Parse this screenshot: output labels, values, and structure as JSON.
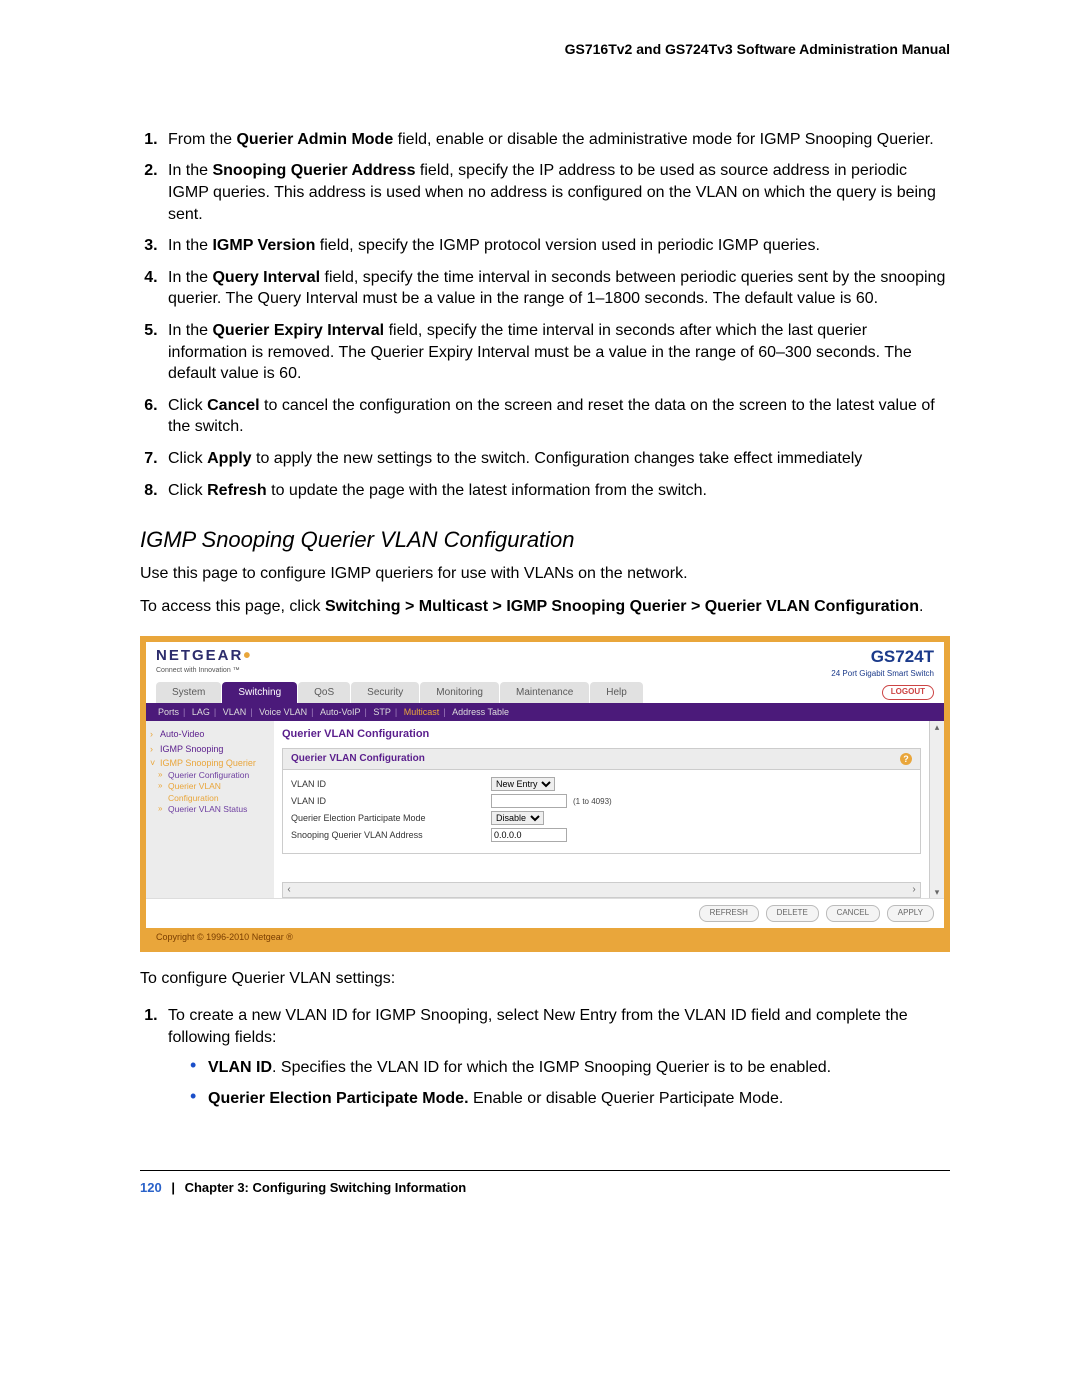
{
  "header": {
    "manual_title": "GS716Tv2 and GS724Tv3 Software Administration Manual"
  },
  "steps_top": [
    {
      "pre": "From the ",
      "bold": "Querier Admin Mode",
      "post": " field, enable or disable the administrative mode for IGMP Snooping Querier."
    },
    {
      "pre": "In the ",
      "bold": "Snooping Querier Address",
      "post": " field, specify the IP address to be used as source address in periodic IGMP queries. This address is used when no address is configured on the VLAN on which the query is being sent."
    },
    {
      "pre": "In the ",
      "bold": "IGMP Version",
      "post": " field, specify the IGMP protocol version used in periodic IGMP queries."
    },
    {
      "pre": "In the ",
      "bold": "Query Interval",
      "post": " field, specify the time interval in seconds between periodic queries sent by the snooping querier. The Query Interval must be a value in the range of 1–1800 seconds. The default value is 60."
    },
    {
      "pre": "In the ",
      "bold": "Querier Expiry Interval",
      "post": " field, specify the time interval in seconds after which the last querier information is removed. The Querier Expiry Interval must be a value in the range of 60–300 seconds. The default value is 60."
    },
    {
      "pre": "Click ",
      "bold": "Cancel",
      "post": " to cancel the configuration on the screen and reset the data on the screen to the latest value of the switch."
    },
    {
      "pre": "Click ",
      "bold": "Apply",
      "post": " to apply the new settings to the switch. Configuration changes take effect immediately"
    },
    {
      "pre": "Click ",
      "bold": "Refresh",
      "post": " to update the page with the latest information from the switch."
    }
  ],
  "section": {
    "heading": "IGMP Snooping Querier VLAN Configuration",
    "intro": "Use this page to configure IGMP queriers for use with VLANs on the network.",
    "access_pre": "To access this page, click ",
    "access_path": "Switching > Multicast > IGMP Snooping Querier > Querier VLAN Configuration",
    "access_post": "."
  },
  "screenshot": {
    "brand": "NETGEAR",
    "tagline": "Connect with Innovation ™",
    "model": "GS724T",
    "model_desc": "24 Port Gigabit Smart Switch",
    "tabs": [
      "System",
      "Switching",
      "QoS",
      "Security",
      "Monitoring",
      "Maintenance",
      "Help"
    ],
    "active_tab_index": 1,
    "logout": "LOGOUT",
    "subtabs": [
      "Ports",
      "LAG",
      "VLAN",
      "Voice VLAN",
      "Auto-VoIP",
      "STP",
      "Multicast",
      "Address Table"
    ],
    "active_subtab_index": 6,
    "sidebar": {
      "items": [
        {
          "label": "Auto-Video",
          "type": "item"
        },
        {
          "label": "IGMP Snooping",
          "type": "item"
        },
        {
          "label": "IGMP Snooping Querier",
          "type": "open",
          "highlight": true
        },
        {
          "label": "Querier Configuration",
          "type": "sub"
        },
        {
          "label": "Querier VLAN Configuration",
          "type": "sub",
          "highlight": true
        },
        {
          "label": "Querier VLAN Status",
          "type": "sub"
        }
      ]
    },
    "panel_title": "Querier VLAN Configuration",
    "box_title": "Querier VLAN Configuration",
    "rows": [
      {
        "label": "VLAN ID",
        "control": "select",
        "value": "New Entry"
      },
      {
        "label": "VLAN ID",
        "control": "text",
        "value": "",
        "hint": "(1 to 4093)"
      },
      {
        "label": "Querier Election Participate Mode",
        "control": "select",
        "value": "Disable"
      },
      {
        "label": "Snooping Querier VLAN Address",
        "control": "text",
        "value": "0.0.0.0"
      }
    ],
    "buttons": [
      "REFRESH",
      "DELETE",
      "CANCEL",
      "APPLY"
    ],
    "copyright": "Copyright © 1996-2010 Netgear ®"
  },
  "after": {
    "configure_line": "To configure Querier VLAN settings:",
    "step1_text": "To create a new VLAN ID for IGMP Snooping, select New Entry from the VLAN ID field and complete the following fields:",
    "bullets": [
      {
        "bold": "VLAN ID",
        "post": ". Specifies the VLAN ID for which the IGMP Snooping Querier is to be enabled."
      },
      {
        "bold": "Querier Election Participate Mode.",
        "post": " Enable or disable Querier Participate Mode."
      }
    ]
  },
  "footer": {
    "page_number": "120",
    "chapter": "Chapter 3:  Configuring Switching Information"
  }
}
